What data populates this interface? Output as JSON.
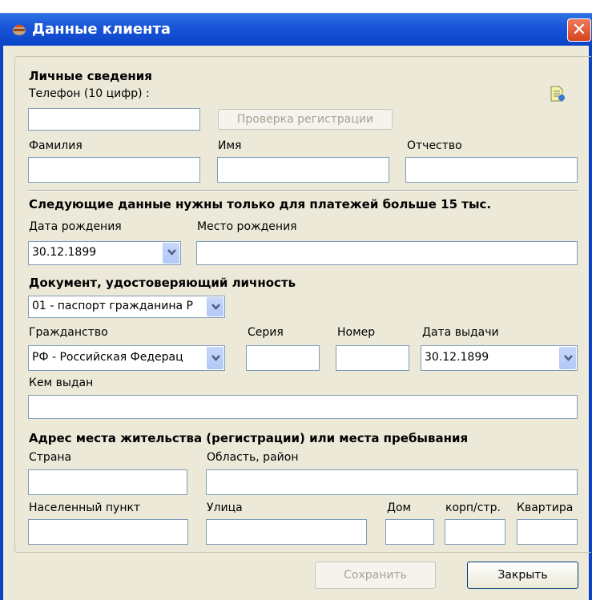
{
  "window": {
    "title": "Данные клиента",
    "close_glyph": "✕"
  },
  "personal": {
    "heading": "Личные сведения",
    "phone_label": "Телефон (10 цифр) :",
    "phone_value": "",
    "check_button": "Проверка регистрации",
    "surname_label": "Фамилия",
    "name_label": "Имя",
    "patronymic_label": "Отчество"
  },
  "extra": {
    "heading": "Следующие данные нужны только для платежей больше 15 тыс.",
    "birth_date_label": "Дата рождения",
    "birth_date_value": "30.12.1899",
    "birth_place_label": "Место рождения"
  },
  "document": {
    "heading": "Документ, удостоверяющий личность",
    "type_value": "01 - паспорт гражданина Р",
    "citizenship_label": "Гражданство",
    "citizenship_value": "РФ - Российская Федерац",
    "series_label": "Серия",
    "number_label": "Номер",
    "issue_date_label": "Дата выдачи",
    "issue_date_value": "30.12.1899",
    "issued_by_label": "Кем выдан"
  },
  "address": {
    "heading": "Адрес места жительства (регистрации) или места пребывания",
    "country_label": "Страна",
    "region_label": "Область, район",
    "locality_label": "Населенный пункт",
    "street_label": "Улица",
    "house_label": "Дом",
    "building_label": "корп/стр.",
    "apartment_label": "Квартира"
  },
  "buttons": {
    "save": "Сохранить",
    "close": "Закрыть"
  },
  "icons": {
    "title": "app-icon",
    "doc": "document-edit-icon"
  }
}
